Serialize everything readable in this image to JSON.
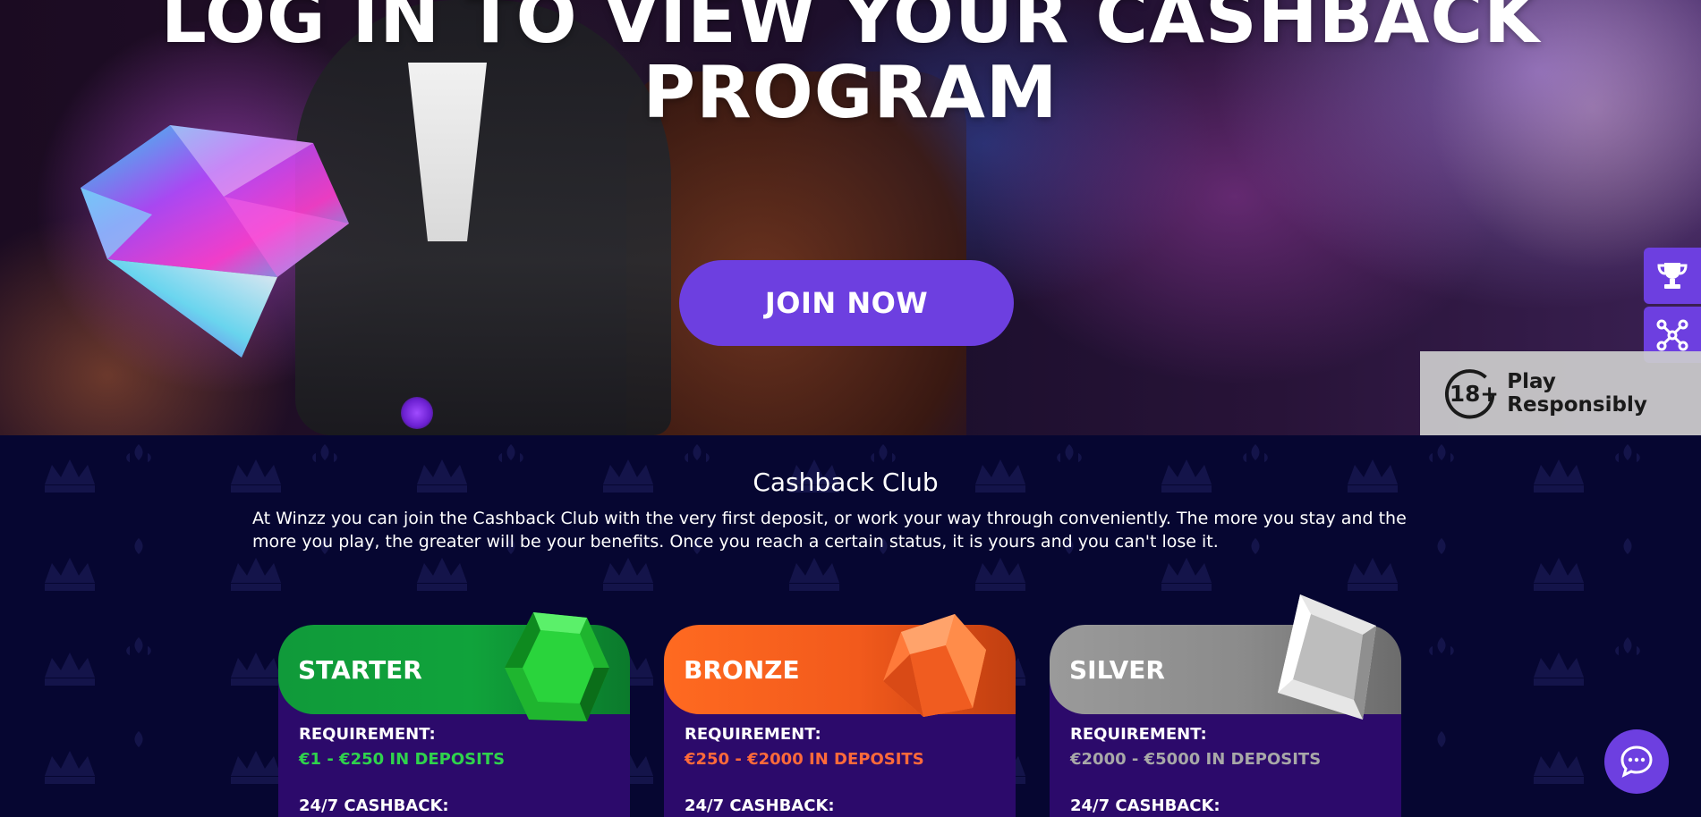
{
  "hero": {
    "title_line1": "LOG IN TO VIEW YOUR CASHBACK",
    "title_line2": "PROGRAM",
    "join_label": "JOIN NOW"
  },
  "side_buttons": [
    {
      "icon": "trophy-icon"
    },
    {
      "icon": "network-icon"
    }
  ],
  "responsible": {
    "badge": "18+",
    "label": "Play Responsibly"
  },
  "club": {
    "title": "Cashback Club",
    "description": "At Winzz you can join the Cashback Club with the very first deposit, or work your way through conveniently. The more you stay and the more you play, the greater will be your benefits. Once you reach a certain status, it is yours and you can't lose it."
  },
  "tiers": [
    {
      "name": "STARTER",
      "requirement_label": "REQUIREMENT:",
      "requirement_value": "€1 - €250 IN DEPOSITS",
      "cashback_label": "24/7 CASHBACK:",
      "color": "#10a33b"
    },
    {
      "name": "BRONZE",
      "requirement_label": "REQUIREMENT:",
      "requirement_value": "€250 - €2000 IN DEPOSITS",
      "cashback_label": "24/7 CASHBACK:",
      "color": "#f25a1c"
    },
    {
      "name": "SILVER",
      "requirement_label": "REQUIREMENT:",
      "requirement_value": "€2000 - €5000 IN DEPOSITS",
      "cashback_label": "24/7 CASHBACK:",
      "color": "#8b8b8b"
    }
  ],
  "chat": {
    "icon": "chat-icon"
  },
  "colors": {
    "accent": "#6d3fe0",
    "background": "#060631",
    "card_body": "#2c0a6b"
  }
}
